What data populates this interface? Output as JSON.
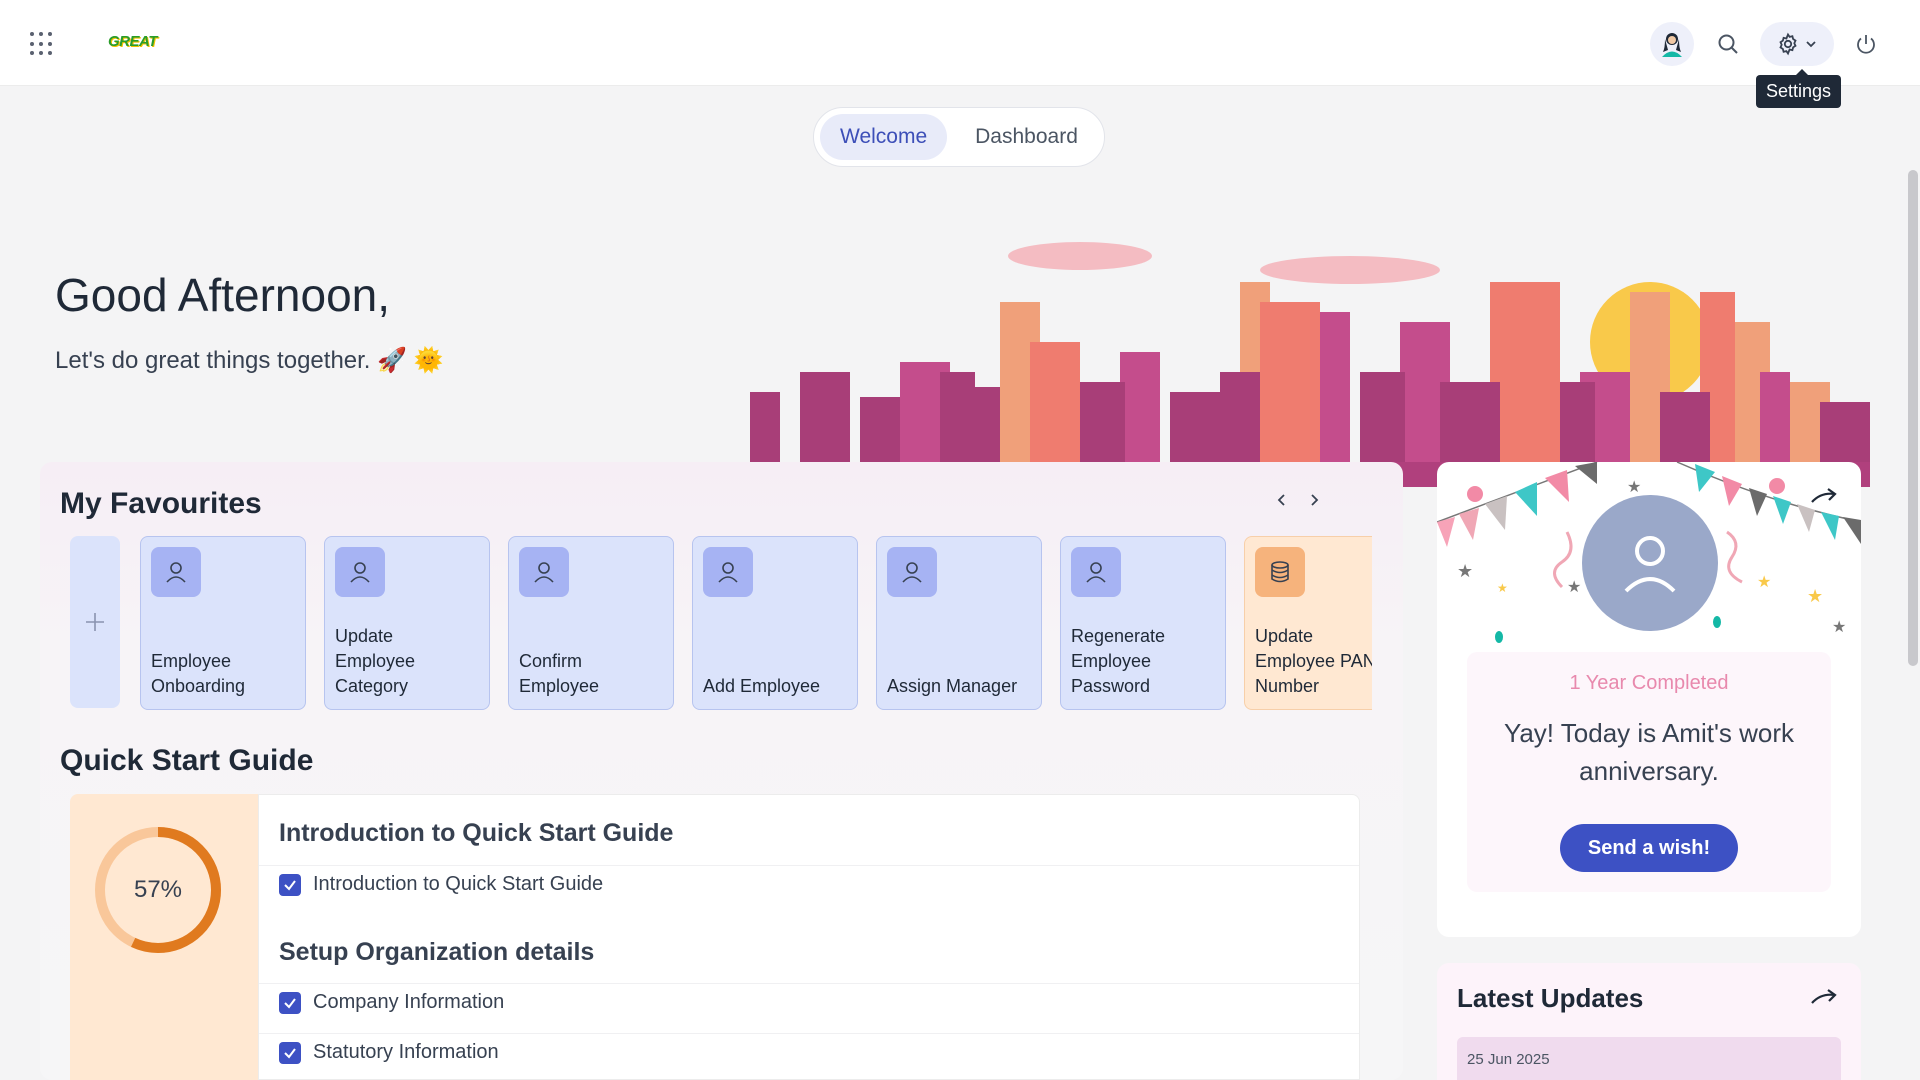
{
  "topbar": {
    "logo_text": "GREAT",
    "tooltip": "Settings",
    "icons": [
      "apps-grid-icon",
      "avatar-icon",
      "search-icon",
      "gear-icon",
      "chevron-down-icon",
      "power-icon"
    ]
  },
  "tabs": [
    {
      "label": "Welcome",
      "active": true
    },
    {
      "label": "Dashboard",
      "active": false
    }
  ],
  "greeting": {
    "title": "Good Afternoon,",
    "subtitle": "Let's do great things together. 🚀 🌞"
  },
  "favourites": {
    "title": "My Favourites",
    "items": [
      {
        "label": "Employee\nOnboarding",
        "icon": "user-icon",
        "color": "#dbe3fb"
      },
      {
        "label": "Update\nEmployee\nCategory",
        "icon": "user-icon",
        "color": "#dbe3fb"
      },
      {
        "label": "Confirm\nEmployee",
        "icon": "user-icon",
        "color": "#dbe3fb"
      },
      {
        "label": "Add Employee",
        "icon": "user-icon",
        "color": "#dbe3fb"
      },
      {
        "label": "Assign Manager",
        "icon": "user-icon",
        "color": "#dbe3fb"
      },
      {
        "label": "Regenerate\nEmployee\nPassword",
        "icon": "user-icon",
        "color": "#dbe3fb"
      },
      {
        "label": "Update\nEmployee PAN\nNumber",
        "icon": "database-icon",
        "color": "#ffe8d2"
      }
    ]
  },
  "quick_start": {
    "title": "Quick Start Guide",
    "progress_percent": 57,
    "progress_label": "57%",
    "sections": [
      {
        "heading": "Introduction to Quick Start Guide",
        "items": [
          "Introduction to Quick Start Guide"
        ]
      },
      {
        "heading": "Setup Organization details",
        "items": [
          "Company Information",
          "Statutory Information"
        ]
      }
    ]
  },
  "anniversary": {
    "badge": "1 Year Completed",
    "message": "Yay! Today is Amit's work anniversary.",
    "button": "Send a wish!"
  },
  "latest_updates": {
    "title": "Latest Updates",
    "first_date": "25 Jun 2025"
  },
  "colors": {
    "accent": "#3d51c4",
    "tab_active_bg": "#e8ebf9",
    "progress": "#e07a1f",
    "progress_track": "#f9c79a"
  }
}
